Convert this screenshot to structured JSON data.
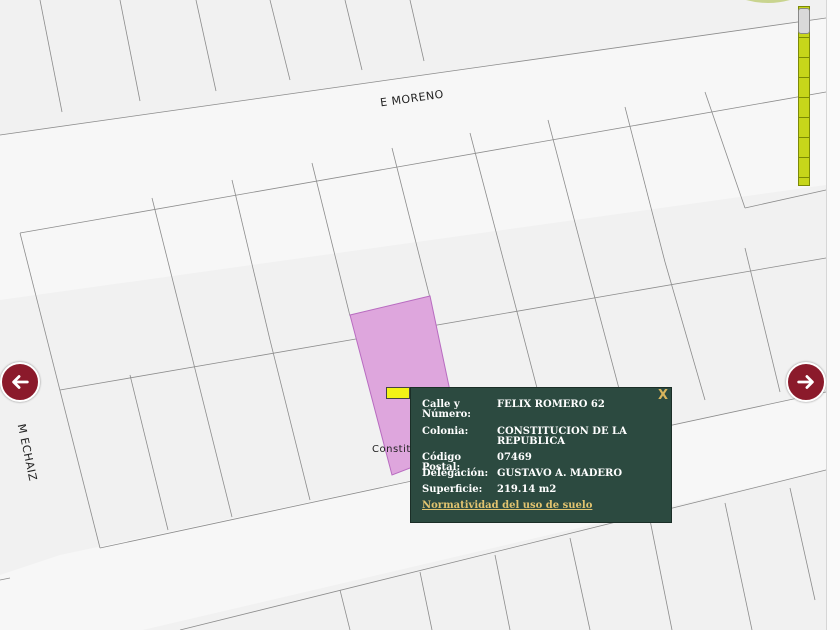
{
  "streets": {
    "top": "E MORENO",
    "left": "M ECHAIZ",
    "bottom_partial": "Constitu"
  },
  "nav": {
    "left_icon": "arrow-left-icon",
    "right_icon": "arrow-right-icon"
  },
  "colors": {
    "parcel_highlight": "#dea6dd",
    "nav_arrow": "#8b1a2b",
    "popup_bg": "#2c4a40",
    "link": "#e1c36f",
    "zoom_bar": "#c7d61a"
  },
  "popup": {
    "close_label": "X",
    "fields": [
      {
        "label": "Calle y Número:",
        "value": "FELIX ROMERO 62"
      },
      {
        "label": "Colonia:",
        "value": "CONSTITUCION DE LA REPUBLICA"
      },
      {
        "label": "Código Postal:",
        "value": "07469"
      },
      {
        "label": "Delegación:",
        "value": "GUSTAVO A. MADERO"
      },
      {
        "label": "Superficie:",
        "value": "219.14 m2"
      }
    ],
    "link_label": "Normatividad del uso de suelo"
  }
}
